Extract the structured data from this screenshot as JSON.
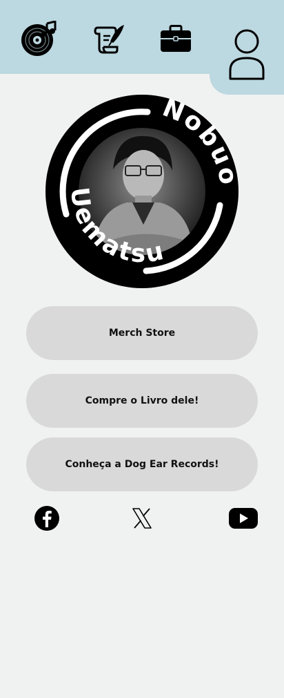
{
  "header": {
    "icons": [
      "music-disc-icon",
      "scroll-quill-icon",
      "briefcase-icon",
      "user-profile-icon"
    ]
  },
  "profile": {
    "name_first": "Nobuo",
    "name_last": "Uematsu",
    "ring_color": "#000000"
  },
  "links": [
    {
      "label": "Merch Store"
    },
    {
      "label": "Compre o Livro dele!"
    },
    {
      "label": "Conheça a Dog Ear Records!"
    }
  ],
  "social": {
    "icons": [
      "facebook-icon",
      "x-icon",
      "youtube-icon"
    ]
  },
  "colors": {
    "header_bg": "#bcd8e0",
    "page_bg": "#f0f2f1",
    "button_bg": "#d9d9d9"
  }
}
